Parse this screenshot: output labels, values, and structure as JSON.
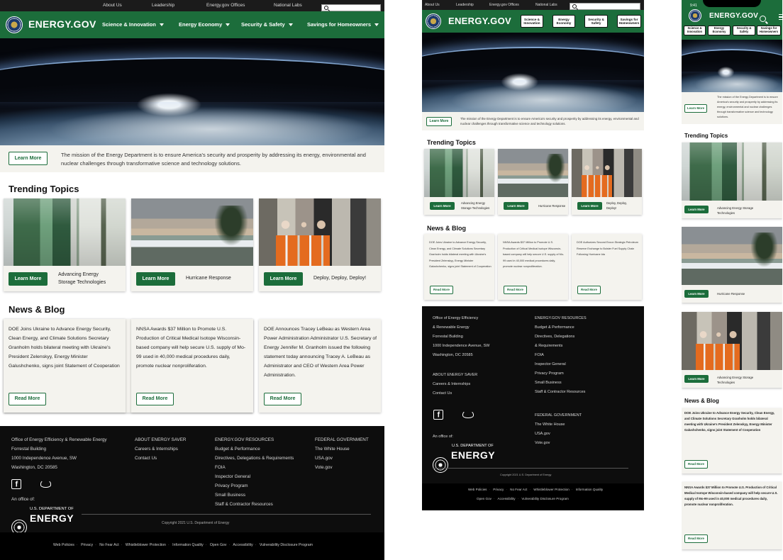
{
  "util_links": [
    "About Us",
    "Leadership",
    "Energy.gov Offices",
    "National Labs"
  ],
  "brand": "ENERGY.GOV",
  "nav": [
    "Science & Innovation",
    "Energy Economy",
    "Security & Safety",
    "Savings for Homeowners"
  ],
  "nav_pills": [
    "Science & Innovation",
    "Energy Economy",
    "Security & Safety",
    "Savings for Homeowners"
  ],
  "mission": {
    "button": "Learn More",
    "text": "The mission of the Energy Department is to ensure America’s security and prosperity by addressing its energy, environmental and nuclear challenges through transformative science and technology solutions."
  },
  "trending": {
    "title": "Trending Topics",
    "items": [
      {
        "label": "Advancing Energy Storage Technologies",
        "button": "Learn More"
      },
      {
        "label": "Hurricane Response",
        "button": "Learn More"
      },
      {
        "label": "Deploy, Deploy, Deploy!",
        "button": "Learn More"
      }
    ]
  },
  "news": {
    "title": "News & Blog",
    "items": [
      {
        "text": "DOE Joins Ukraine to Advance Energy Security, Clean Energy, and Climate Solutions Secretary Granholm holds bilateral meeting with Ukraine’s President Zelenskyy, Energy Minister Galushchenko, signs joint Statement of Cooperation",
        "button": "Read More"
      },
      {
        "text": "NNSA Awards $37 Million to Promote U.S. Production of Critical Medical Isotope Wisconsin-based company will help secure U.S. supply of Mo-99 used in 40,000 medical procedures daily, promote nuclear nonproliferation.",
        "button": "Read More"
      },
      {
        "text": "DOE Announces Tracey LeBeau as Western Area Power Administration Administrator U.S. Secretary of Energy Jennifer M. Granholm issued the following statement today announcing Tracey A. LeBeau as Administrator and CEO of Western Area Power Administration.",
        "button": "Read More"
      }
    ],
    "tablet_items": [
      "DOE Joins Ukraine to Advance Energy Security, Clean Energy, and Climate Solutions Secretary Granholm holds bilateral meeting with Ukraine's President Zelenskyy, Energy Minister Galushchenko, signs joint Statement of Cooperation",
      "NNSA Awards $37 Million to Promote U.S. Production of Critical Medical Isotope Wisconsin-based company will help secure U.S. supply of Mo-99 used in 40,000 medical procedures daily, promote nuclear nonproliferation.",
      "DOE Authorizes Second Exxon Strategic Petroleum Reserve Exchange to Bolster Fuel Supply Chain Following Hurricane Ida"
    ]
  },
  "footer": {
    "address": [
      "Office of Energy Efficiency & Renewable Energy",
      "Forrestal Building",
      "1000 Independence Avenue, SW",
      "Washington, DC 20585"
    ],
    "address_tablet": [
      "Office of Energy Efficiency",
      "& Renewable Energy",
      "Forrestal Building",
      "1000 Independence Avenue, SW",
      "Washington, DC 20585"
    ],
    "about_title": "ABOUT ENERGY SAVER",
    "about_links": [
      "Careers & Internships",
      "Contact Us"
    ],
    "resources_title": "ENERGY.GOV RESOURCES",
    "resources_links": [
      "Budget & Performance",
      "Directives, Delegations & Requirements",
      "FOIA",
      "Inspector General",
      "Privacy Program",
      "Small Business",
      "Staff & Contractor Resources"
    ],
    "resources_links_tablet": [
      "Budget & Performance",
      "Directives, Delegations",
      "& Requirements",
      "FOIA",
      "Inspector General",
      "Privacy Program",
      "Small Business",
      "Staff & Contractor Resources"
    ],
    "federal_title": "FEDERAL GOVERNMENT",
    "federal_links": [
      "The White House",
      "USA.gov",
      "Vote.gov"
    ],
    "office_of": "An office of:",
    "us_dept": "U.S. DEPARTMENT OF",
    "energy": "ENERGY",
    "copyright": "Copyright 2021 U.S. Department of Energy",
    "bottom_links": [
      "Web Policies",
      "Privacy",
      "No Fear Act",
      "Whistleblower Protection",
      "Information Quality",
      "Open Gov",
      "Accessibility",
      "Vulnerability Disclosure Program"
    ]
  },
  "mobile": {
    "time": "9:41",
    "mission_text": "The mission of the Energy Department is to ensure America's security and prosperity by addressing its energy, environmental and nuclear challenges through transformative science and technology solutions.",
    "trending_labels": [
      "Advancing Energy Storage Technologies",
      "Hurricane Response",
      "Advancing Energy Storage Technologies"
    ],
    "news_items": [
      "DOE Joins Ukraine to Advance Energy Security, Clean Energy, and Climate Solutions Secretary Granholm holds bilateral meeting with Ukraine's President Zelenskyy, Energy Minister Galushchenko, signs joint Statement of Cooperation",
      "NNSA Awards $37 Million to Promote U.S. Production of Critical Medical Isotope Wisconsin-based company will help secure U.S. supply of Mo-99 used in 40,000 medical procedures daily, promote nuclear nonproliferation."
    ]
  }
}
